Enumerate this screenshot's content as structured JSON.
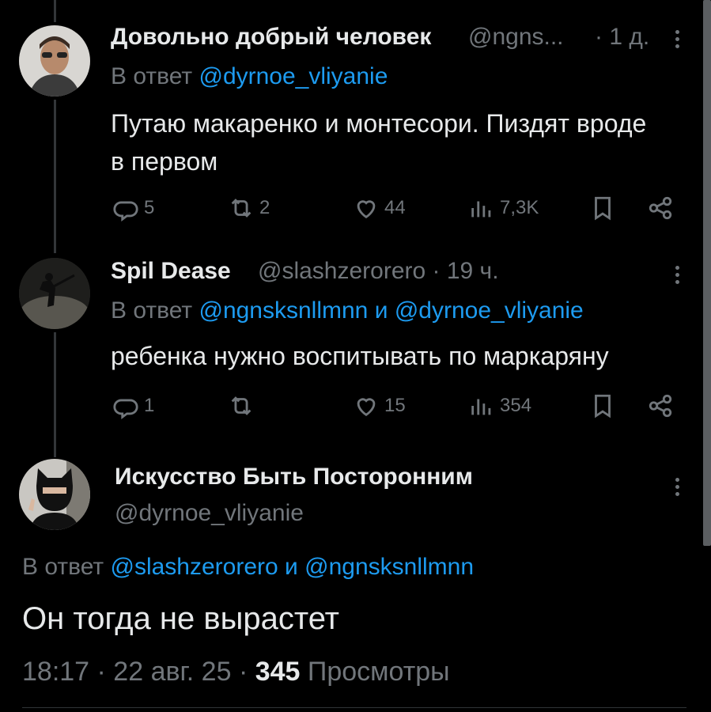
{
  "tweets": [
    {
      "author_name": "Довольно добрый человек",
      "handle": "@ngns...",
      "time": "· 1 д.",
      "reply_prefix": "В ответ",
      "reply_to": "@dyrnoe_vliyanie",
      "text": "Путаю макаренко и монтесори. Пиздят вроде в первом",
      "stats": {
        "replies": "5",
        "retweets": "2",
        "likes": "44",
        "views": "7,3K"
      }
    },
    {
      "author_name": "Spil Dease",
      "handle": "@slashzerorero · 19 ч.",
      "reply_prefix": "В ответ",
      "reply_to_1": "@ngnsksnllmnn",
      "reply_and": "и",
      "reply_to_2": "@dyrnoe_vliyanie",
      "text": "ребенка нужно воспитывать по маркаряну",
      "stats": {
        "replies": "1",
        "retweets": "",
        "likes": "15",
        "views": "354"
      }
    }
  ],
  "main_tweet": {
    "author_name": "Искусство Быть Посторонним",
    "handle": "@dyrnoe_vliyanie",
    "reply_prefix": "В ответ",
    "reply_to_1": "@slashzerorero",
    "reply_and": "и",
    "reply_to_2": "@ngnsksnllmnn",
    "text": "Он тогда не вырастет",
    "time": "18:17 · 22 авг. 25 ·",
    "views_count": "345",
    "views_label": "Просмотры"
  },
  "icons": [
    "reply-icon",
    "retweet-icon",
    "like-icon",
    "views-icon",
    "bookmark-icon",
    "share-icon",
    "more-icon"
  ],
  "colors": {
    "background": "#000000",
    "text": "#e7e9ea",
    "muted": "#71767b",
    "link": "#1d9bf0"
  }
}
